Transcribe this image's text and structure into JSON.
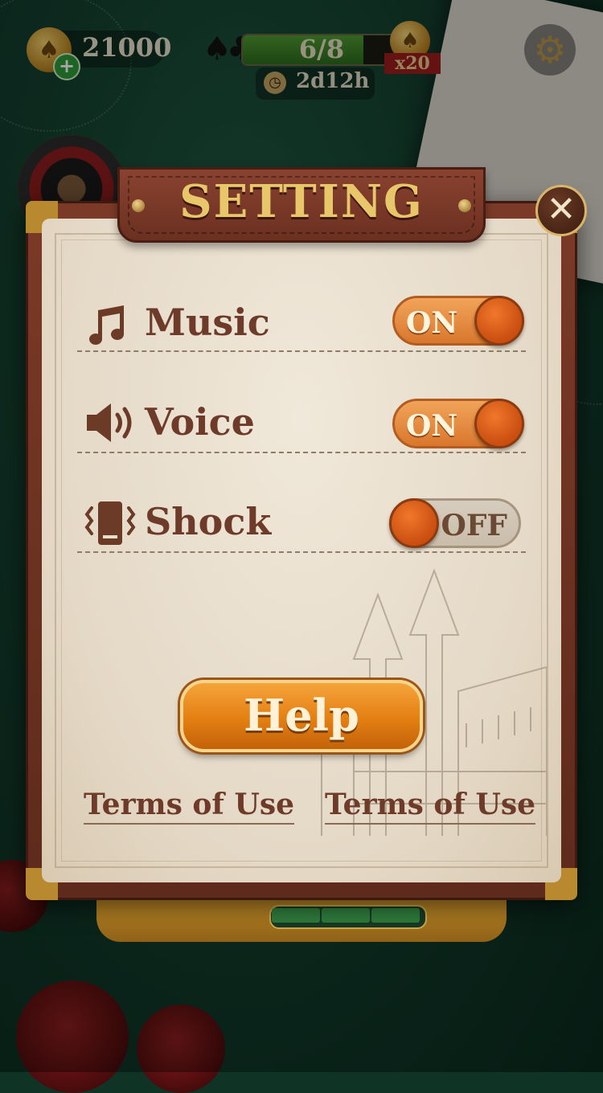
{
  "hud": {
    "coins": "21000",
    "plus_symbol": "+",
    "progress_text": "6/8",
    "progress_fraction": 0.75,
    "multiplier": "x20",
    "timer": "2d12h",
    "suits_symbol": "♠♣"
  },
  "dialog": {
    "title": "SETTING",
    "close_symbol": "✕",
    "settings": [
      {
        "label": "Music",
        "icon": "music-note-icon",
        "state": "ON"
      },
      {
        "label": "Voice",
        "icon": "speaker-icon",
        "state": "ON"
      },
      {
        "label": "Shock",
        "icon": "vibrate-phone-icon",
        "state": "OFF"
      }
    ],
    "help_label": "Help",
    "links": [
      "Terms of Use",
      "Terms of Use"
    ]
  },
  "colors": {
    "toggle_on": "#e0862f",
    "knob": "#d9591a",
    "title_gold": "#e7c76a",
    "leather": "#7b3a27"
  }
}
